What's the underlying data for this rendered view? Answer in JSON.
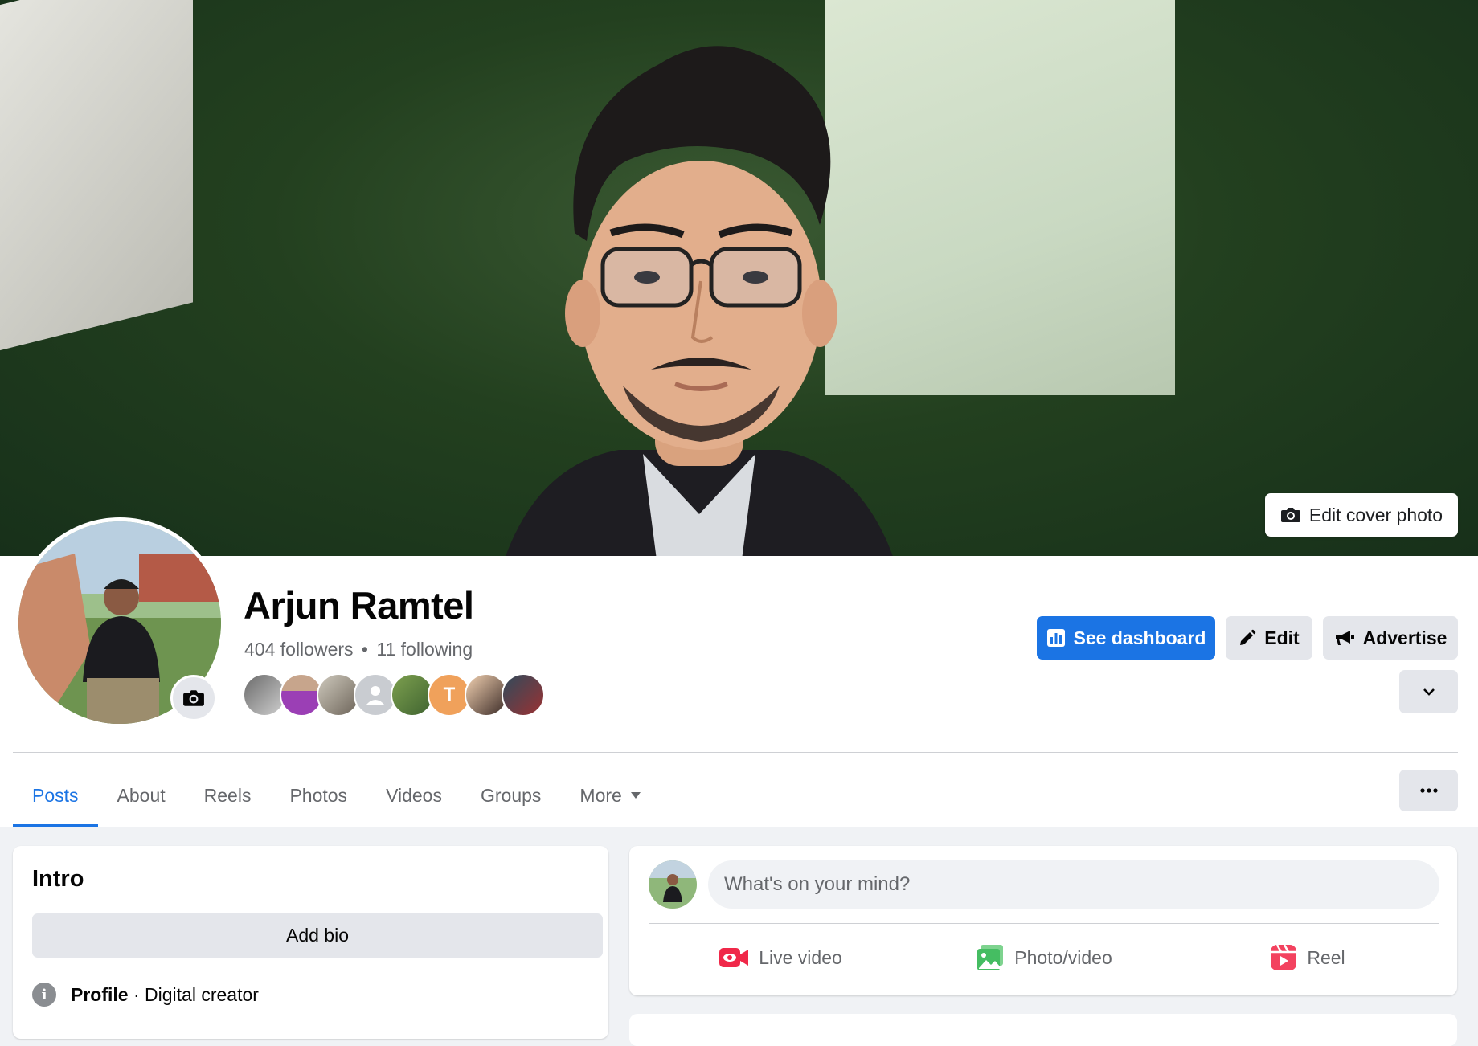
{
  "cover": {
    "edit_cover_label": "Edit cover photo"
  },
  "profile": {
    "name": "Arjun Ramtel",
    "followers_text": "404 followers",
    "separator": "•",
    "following_text": "11 following",
    "friend_initial": "T"
  },
  "actions": {
    "dashboard_label": "See dashboard",
    "edit_label": "Edit",
    "advertise_label": "Advertise"
  },
  "tabs": [
    {
      "label": "Posts"
    },
    {
      "label": "About"
    },
    {
      "label": "Reels"
    },
    {
      "label": "Photos"
    },
    {
      "label": "Videos"
    },
    {
      "label": "Groups"
    },
    {
      "label": "More"
    }
  ],
  "intro": {
    "title": "Intro",
    "add_bio_label": "Add bio",
    "profile_label": "Profile",
    "profile_detail": " · Digital creator"
  },
  "composer": {
    "placeholder": "What's on your mind?",
    "live_video_label": "Live video",
    "photo_video_label": "Photo/video",
    "reel_label": "Reel"
  },
  "colors": {
    "accent": "#1b74e4",
    "live_red": "#f02849",
    "photo_green": "#45bd62",
    "reel_pink": "#f3425f",
    "secondary_text": "#65676b"
  },
  "icons": [
    "camera-icon",
    "dashboard-icon",
    "pencil-icon",
    "megaphone-icon",
    "chevron-down-icon",
    "more-horizontal-icon",
    "info-icon",
    "live-video-icon",
    "photo-icon",
    "reel-icon"
  ]
}
